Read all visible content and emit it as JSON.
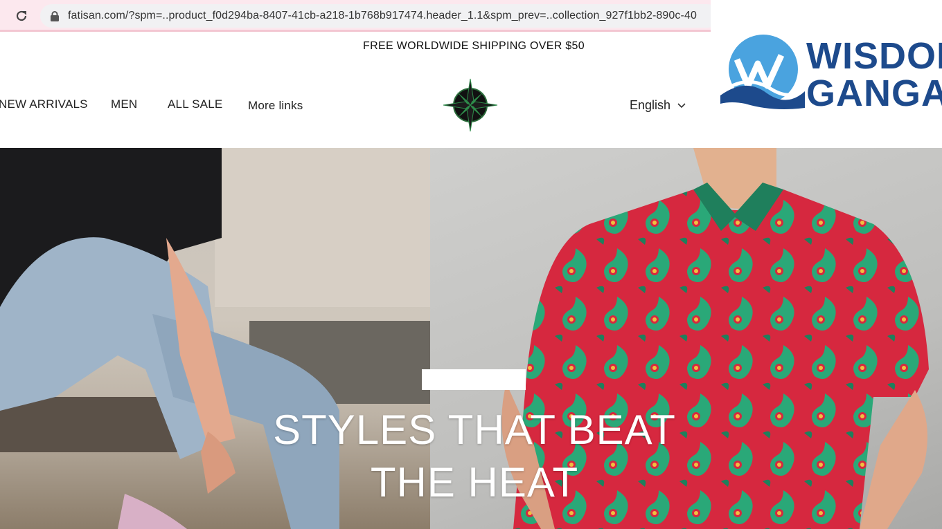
{
  "browser": {
    "url": "fatisan.com/?spm=..product_f0d294ba-8407-41cb-a218-1b768b917474.header_1.1&spm_prev=..collection_927f1bb2-890c-40"
  },
  "watermark": {
    "line1": "WISDOM",
    "line2": "GANGA"
  },
  "announcement": "FREE WORLDWIDE SHIPPING OVER $50",
  "nav": {
    "items": [
      "NEW ARRIVALS",
      "MEN",
      "ALL SALE",
      "More links"
    ]
  },
  "language": {
    "selected": "English"
  },
  "hero": {
    "line1": "STYLES THAT BEAT",
    "line2": "THE HEAT"
  },
  "colors": {
    "browser_bar": "#fce8ee",
    "watermark_blue": "#1d4a8c",
    "watermark_light_blue": "#4aa3df"
  }
}
